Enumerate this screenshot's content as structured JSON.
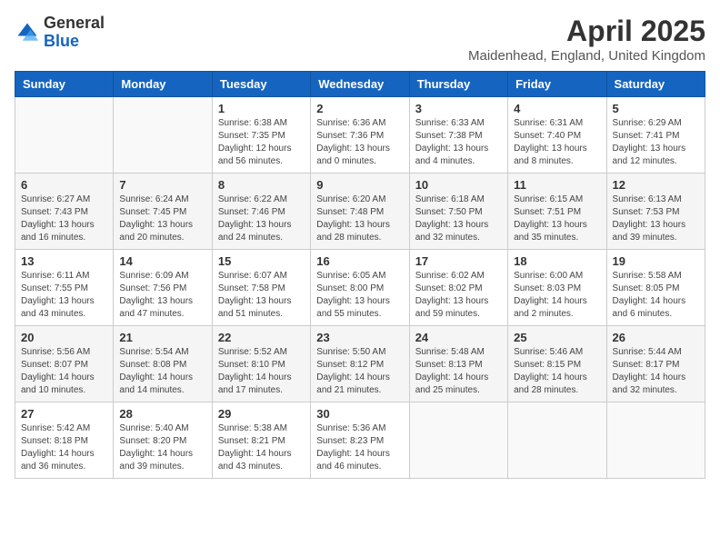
{
  "logo": {
    "general": "General",
    "blue": "Blue"
  },
  "title": "April 2025",
  "location": "Maidenhead, England, United Kingdom",
  "days_of_week": [
    "Sunday",
    "Monday",
    "Tuesday",
    "Wednesday",
    "Thursday",
    "Friday",
    "Saturday"
  ],
  "weeks": [
    [
      {
        "day": "",
        "info": ""
      },
      {
        "day": "",
        "info": ""
      },
      {
        "day": "1",
        "info": "Sunrise: 6:38 AM\nSunset: 7:35 PM\nDaylight: 12 hours and 56 minutes."
      },
      {
        "day": "2",
        "info": "Sunrise: 6:36 AM\nSunset: 7:36 PM\nDaylight: 13 hours and 0 minutes."
      },
      {
        "day": "3",
        "info": "Sunrise: 6:33 AM\nSunset: 7:38 PM\nDaylight: 13 hours and 4 minutes."
      },
      {
        "day": "4",
        "info": "Sunrise: 6:31 AM\nSunset: 7:40 PM\nDaylight: 13 hours and 8 minutes."
      },
      {
        "day": "5",
        "info": "Sunrise: 6:29 AM\nSunset: 7:41 PM\nDaylight: 13 hours and 12 minutes."
      }
    ],
    [
      {
        "day": "6",
        "info": "Sunrise: 6:27 AM\nSunset: 7:43 PM\nDaylight: 13 hours and 16 minutes."
      },
      {
        "day": "7",
        "info": "Sunrise: 6:24 AM\nSunset: 7:45 PM\nDaylight: 13 hours and 20 minutes."
      },
      {
        "day": "8",
        "info": "Sunrise: 6:22 AM\nSunset: 7:46 PM\nDaylight: 13 hours and 24 minutes."
      },
      {
        "day": "9",
        "info": "Sunrise: 6:20 AM\nSunset: 7:48 PM\nDaylight: 13 hours and 28 minutes."
      },
      {
        "day": "10",
        "info": "Sunrise: 6:18 AM\nSunset: 7:50 PM\nDaylight: 13 hours and 32 minutes."
      },
      {
        "day": "11",
        "info": "Sunrise: 6:15 AM\nSunset: 7:51 PM\nDaylight: 13 hours and 35 minutes."
      },
      {
        "day": "12",
        "info": "Sunrise: 6:13 AM\nSunset: 7:53 PM\nDaylight: 13 hours and 39 minutes."
      }
    ],
    [
      {
        "day": "13",
        "info": "Sunrise: 6:11 AM\nSunset: 7:55 PM\nDaylight: 13 hours and 43 minutes."
      },
      {
        "day": "14",
        "info": "Sunrise: 6:09 AM\nSunset: 7:56 PM\nDaylight: 13 hours and 47 minutes."
      },
      {
        "day": "15",
        "info": "Sunrise: 6:07 AM\nSunset: 7:58 PM\nDaylight: 13 hours and 51 minutes."
      },
      {
        "day": "16",
        "info": "Sunrise: 6:05 AM\nSunset: 8:00 PM\nDaylight: 13 hours and 55 minutes."
      },
      {
        "day": "17",
        "info": "Sunrise: 6:02 AM\nSunset: 8:02 PM\nDaylight: 13 hours and 59 minutes."
      },
      {
        "day": "18",
        "info": "Sunrise: 6:00 AM\nSunset: 8:03 PM\nDaylight: 14 hours and 2 minutes."
      },
      {
        "day": "19",
        "info": "Sunrise: 5:58 AM\nSunset: 8:05 PM\nDaylight: 14 hours and 6 minutes."
      }
    ],
    [
      {
        "day": "20",
        "info": "Sunrise: 5:56 AM\nSunset: 8:07 PM\nDaylight: 14 hours and 10 minutes."
      },
      {
        "day": "21",
        "info": "Sunrise: 5:54 AM\nSunset: 8:08 PM\nDaylight: 14 hours and 14 minutes."
      },
      {
        "day": "22",
        "info": "Sunrise: 5:52 AM\nSunset: 8:10 PM\nDaylight: 14 hours and 17 minutes."
      },
      {
        "day": "23",
        "info": "Sunrise: 5:50 AM\nSunset: 8:12 PM\nDaylight: 14 hours and 21 minutes."
      },
      {
        "day": "24",
        "info": "Sunrise: 5:48 AM\nSunset: 8:13 PM\nDaylight: 14 hours and 25 minutes."
      },
      {
        "day": "25",
        "info": "Sunrise: 5:46 AM\nSunset: 8:15 PM\nDaylight: 14 hours and 28 minutes."
      },
      {
        "day": "26",
        "info": "Sunrise: 5:44 AM\nSunset: 8:17 PM\nDaylight: 14 hours and 32 minutes."
      }
    ],
    [
      {
        "day": "27",
        "info": "Sunrise: 5:42 AM\nSunset: 8:18 PM\nDaylight: 14 hours and 36 minutes."
      },
      {
        "day": "28",
        "info": "Sunrise: 5:40 AM\nSunset: 8:20 PM\nDaylight: 14 hours and 39 minutes."
      },
      {
        "day": "29",
        "info": "Sunrise: 5:38 AM\nSunset: 8:21 PM\nDaylight: 14 hours and 43 minutes."
      },
      {
        "day": "30",
        "info": "Sunrise: 5:36 AM\nSunset: 8:23 PM\nDaylight: 14 hours and 46 minutes."
      },
      {
        "day": "",
        "info": ""
      },
      {
        "day": "",
        "info": ""
      },
      {
        "day": "",
        "info": ""
      }
    ]
  ]
}
